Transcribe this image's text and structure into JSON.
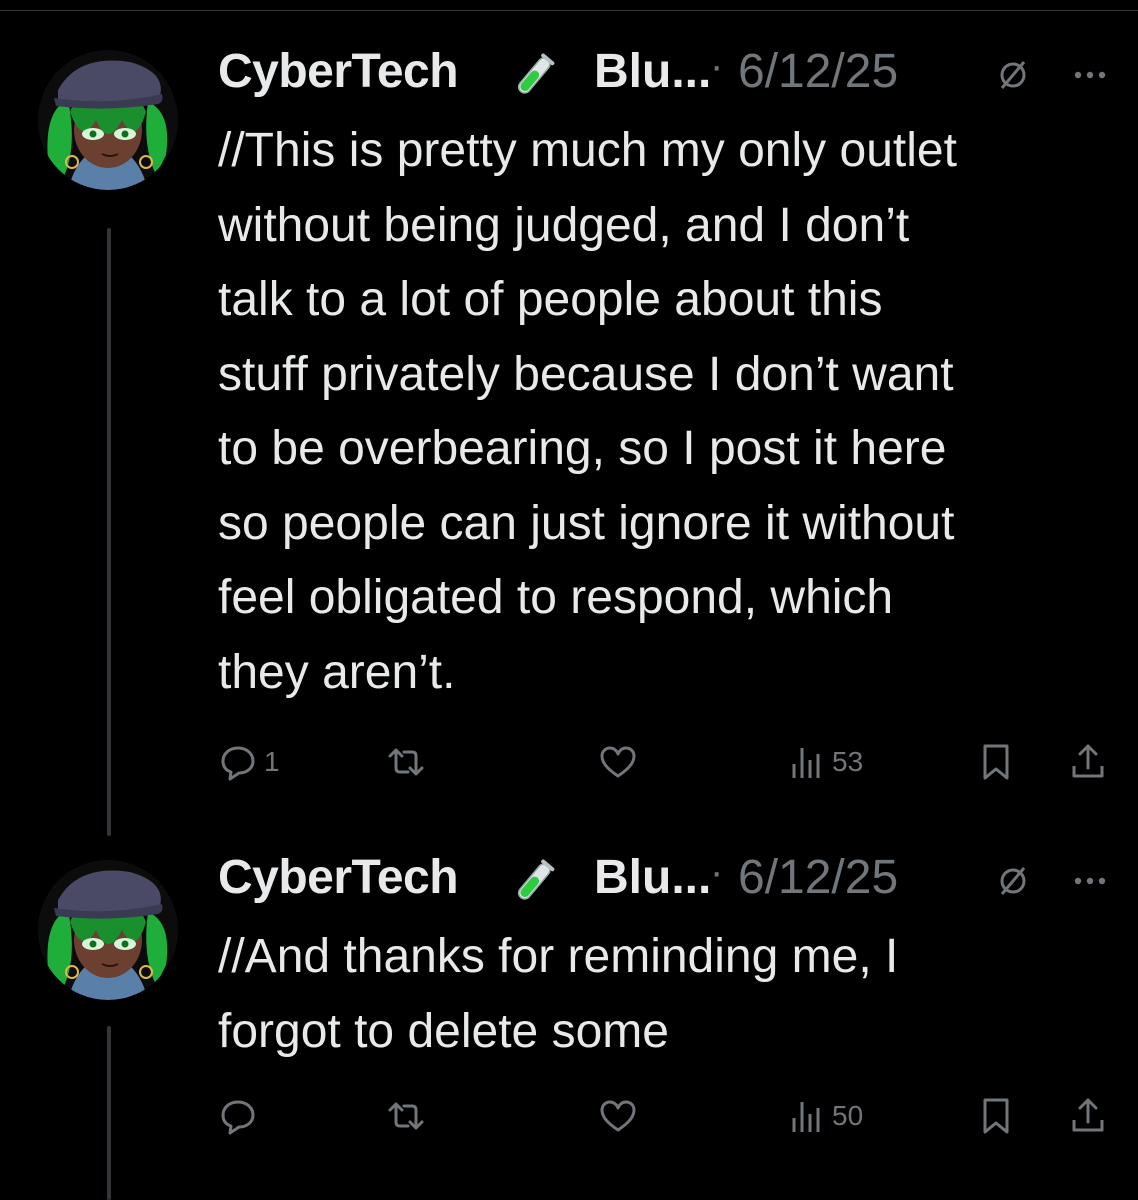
{
  "colors": {
    "background": "#000000",
    "text": "#e7e9ea",
    "muted": "#71767b",
    "accent_green": "#2ecc40",
    "thread_line": "#333639"
  },
  "tweets": [
    {
      "author_name": "CyberTech",
      "emoji": "test-tube-icon",
      "handle": "Blu...",
      "separator": "·",
      "date": "6/12/25",
      "lines": [
        "//This is pretty much my only outlet",
        "without being judged, and I don’t",
        "talk to a lot of people about this",
        "stuff privately because I don’t want",
        "to be overbearing, so I post it here",
        "so people can just ignore it without",
        "feel obligated to respond, which",
        "they aren’t."
      ],
      "reply_count": "1",
      "repost_count": "",
      "like_count": "",
      "view_count": "53"
    },
    {
      "author_name": "CyberTech",
      "emoji": "test-tube-icon",
      "handle": "Blu...",
      "separator": "·",
      "date": "6/12/25",
      "lines": [
        "//And thanks for reminding me, I",
        "forgot to delete some"
      ],
      "reply_count": "",
      "repost_count": "",
      "like_count": "",
      "view_count": "50"
    }
  ]
}
